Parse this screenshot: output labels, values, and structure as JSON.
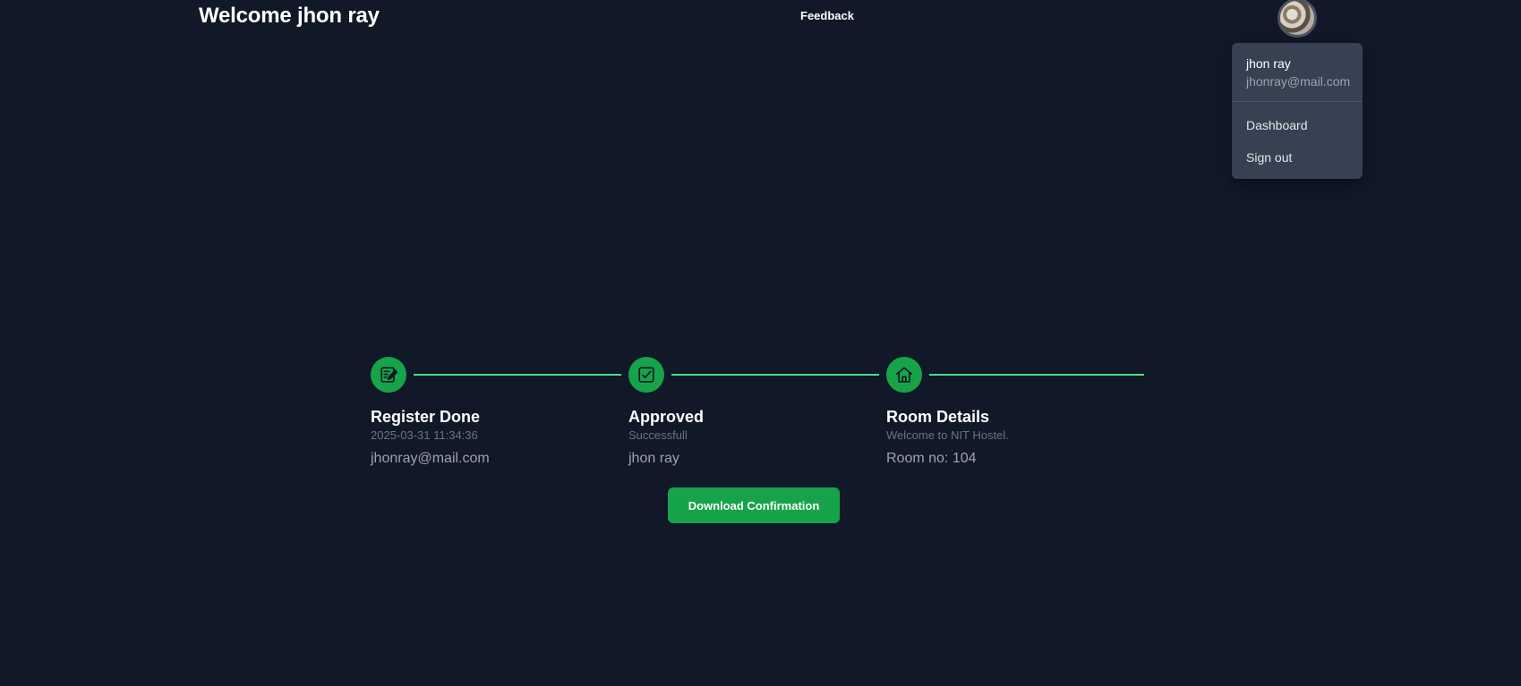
{
  "header": {
    "welcome": "Welcome jhon ray",
    "feedback_label": "Feedback"
  },
  "user_menu": {
    "name": "jhon ray",
    "email": "jhonray@mail.com",
    "items": [
      {
        "label": "Dashboard"
      },
      {
        "label": "Sign out"
      }
    ]
  },
  "timeline": {
    "steps": [
      {
        "icon": "edit-note-icon",
        "title": "Register Done",
        "subtitle": "2025-03-31 11:34:36",
        "detail": "jhonray@mail.com"
      },
      {
        "icon": "checkbox-icon",
        "title": "Approved",
        "subtitle": "Successfull",
        "detail": "jhon ray"
      },
      {
        "icon": "home-icon",
        "title": "Room Details",
        "subtitle": "Welcome to NIT Hostel.",
        "detail": "Room no: 104"
      }
    ]
  },
  "download_label": "Download Confirmation",
  "colors": {
    "background": "#111827",
    "accent": "#16a34a",
    "line": "#4ade80",
    "menu_bg": "#374151"
  }
}
